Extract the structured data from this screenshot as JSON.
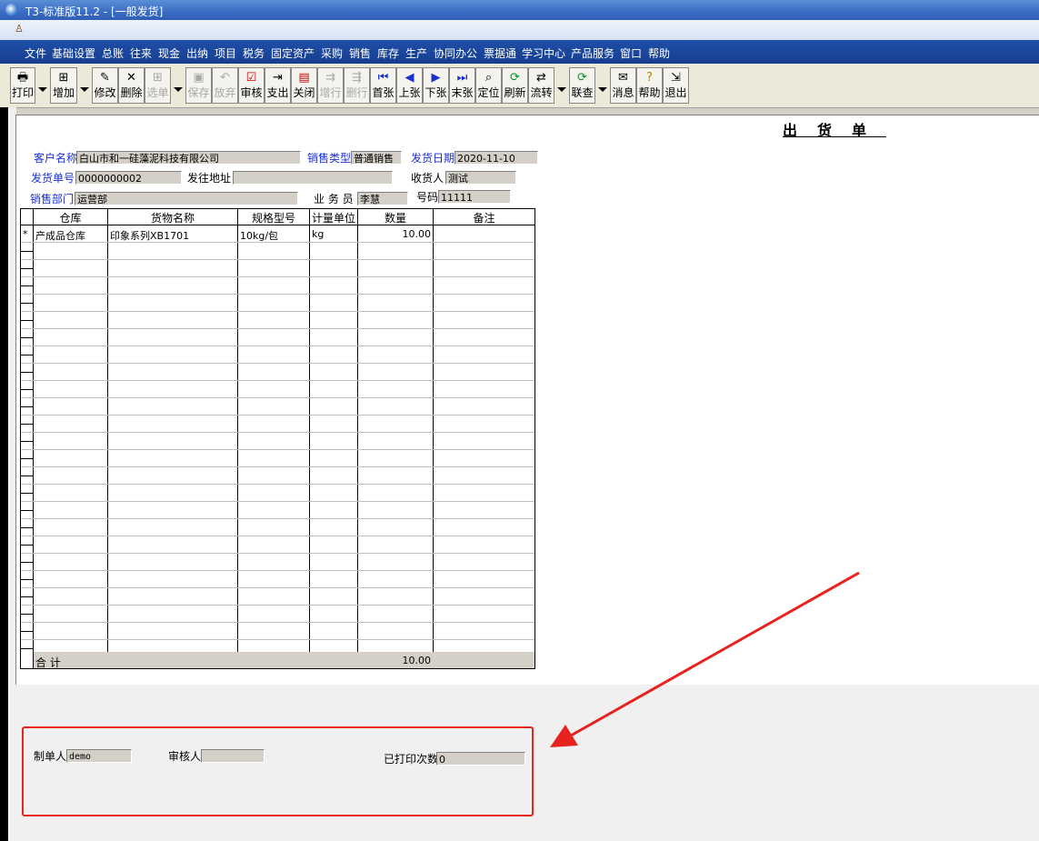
{
  "window": {
    "title": "T3-标准版11.2 - [一般发货]"
  },
  "menu": [
    "文件",
    "基础设置",
    "总账",
    "往来",
    "现金",
    "出纳",
    "项目",
    "税务",
    "固定资产",
    "采购",
    "销售",
    "库存",
    "生产",
    "协同办公",
    "票据通",
    "学习中心",
    "产品服务",
    "窗口",
    "帮助"
  ],
  "toolbar": [
    {
      "label": "打印",
      "icon": "printer-icon",
      "enabled": true
    },
    {
      "label": "增加",
      "icon": "add-doc-icon",
      "enabled": true
    },
    {
      "label": "修改",
      "icon": "edit-icon",
      "enabled": true
    },
    {
      "label": "删除",
      "icon": "delete-icon",
      "enabled": true
    },
    {
      "label": "选单",
      "icon": "select-doc-icon",
      "enabled": false
    },
    {
      "label": "保存",
      "icon": "save-icon",
      "enabled": false
    },
    {
      "label": "放弃",
      "icon": "undo-icon",
      "enabled": false
    },
    {
      "label": "审核",
      "icon": "audit-icon",
      "enabled": true
    },
    {
      "label": "支出",
      "icon": "expense-icon",
      "enabled": true
    },
    {
      "label": "关闭",
      "icon": "close-doc-icon",
      "enabled": true
    },
    {
      "label": "增行",
      "icon": "add-row-icon",
      "enabled": false
    },
    {
      "label": "删行",
      "icon": "delete-row-icon",
      "enabled": false
    },
    {
      "label": "首张",
      "icon": "first-icon",
      "enabled": true
    },
    {
      "label": "上张",
      "icon": "prev-icon",
      "enabled": true
    },
    {
      "label": "下张",
      "icon": "next-icon",
      "enabled": true
    },
    {
      "label": "末张",
      "icon": "last-icon",
      "enabled": true
    },
    {
      "label": "定位",
      "icon": "locate-icon",
      "enabled": true
    },
    {
      "label": "刷新",
      "icon": "refresh-icon",
      "enabled": true
    },
    {
      "label": "流转",
      "icon": "flow-icon",
      "enabled": true
    },
    {
      "label": "联查",
      "icon": "linked-query-icon",
      "enabled": true
    },
    {
      "label": "消息",
      "icon": "message-icon",
      "enabled": true
    },
    {
      "label": "帮助",
      "icon": "help-icon",
      "enabled": true
    },
    {
      "label": "退出",
      "icon": "exit-icon",
      "enabled": true
    }
  ],
  "form": {
    "title": "出货单",
    "customer_label": "客户名称",
    "customer_value": "白山市和一硅藻泥科技有限公司",
    "sales_type_label": "销售类型",
    "sales_type_value": "普通销售",
    "ship_date_label": "发货日期",
    "ship_date_value": "2020-11-10",
    "ship_no_label": "发货单号",
    "ship_no_value": "0000000002",
    "ship_addr_label": "发往地址",
    "ship_addr_value": "",
    "receiver_label": "收货人",
    "receiver_value": "测试",
    "dept_label": "销售部门",
    "dept_value": "运营部",
    "salesman_label": "业 务 员",
    "salesman_value": "李慧",
    "phone_label": "号码",
    "phone_value": "11111"
  },
  "grid": {
    "columns": [
      "仓库",
      "货物名称",
      "规格型号",
      "计量单位",
      "数量",
      "备注"
    ],
    "rows": [
      {
        "marker": "*",
        "warehouse": "产成品仓库",
        "goods": "印象系列XB1701",
        "spec": "10kg/包",
        "unit": "kg",
        "qty": "10.00",
        "note": ""
      }
    ],
    "total_label": "合  计",
    "total_qty": "10.00"
  },
  "footer": {
    "maker_label": "制单人",
    "maker_value": "demo",
    "auditor_label": "审核人",
    "auditor_value": "",
    "print_count_label": "已打印次数",
    "print_count_value": "0"
  },
  "colors": {
    "annotation": "#e8221f",
    "label_blue": "#1a2fd0"
  }
}
